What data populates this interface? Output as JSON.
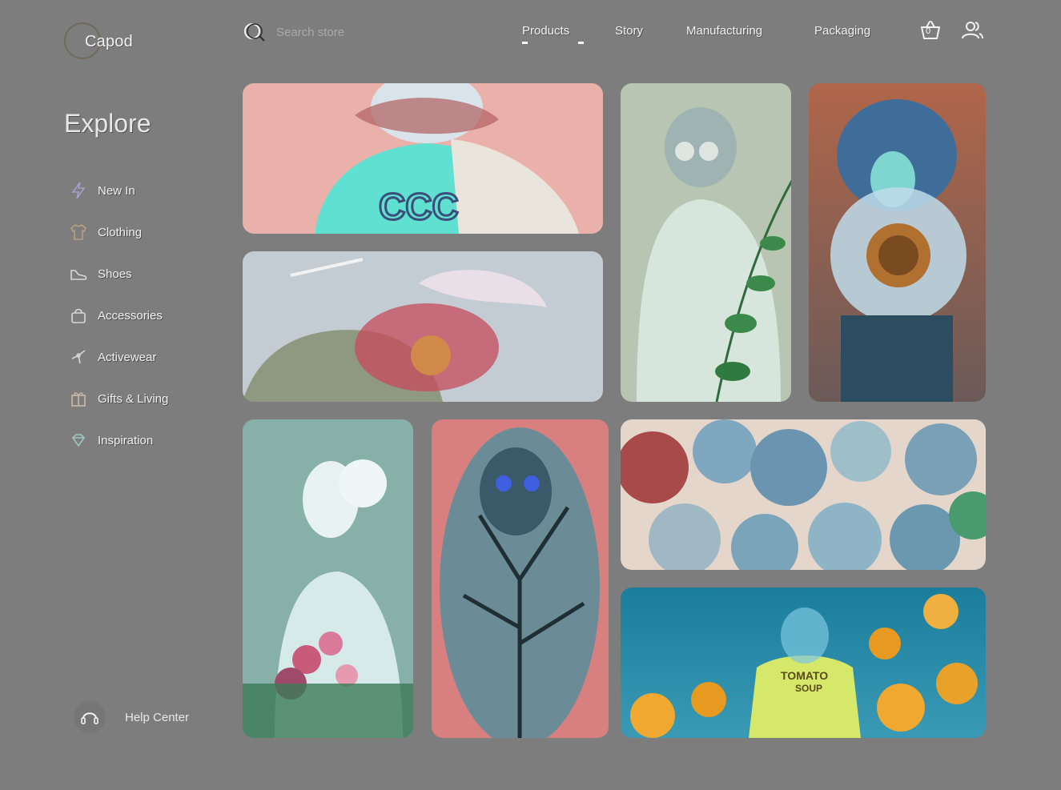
{
  "brand": {
    "name": "Capod"
  },
  "search": {
    "placeholder": "Search store"
  },
  "nav": {
    "items": [
      {
        "label": "Products",
        "active": true
      },
      {
        "label": "Story"
      },
      {
        "label": "Manufacturing"
      },
      {
        "label": "Packaging"
      }
    ],
    "cart_icon": "basket-icon",
    "cart_count": "0",
    "account_icon": "users-icon"
  },
  "sidebar": {
    "title": "Explore",
    "items": [
      {
        "label": "New In",
        "icon": "lightning-icon"
      },
      {
        "label": "Clothing",
        "icon": "shirt-icon"
      },
      {
        "label": "Shoes",
        "icon": "shoe-icon"
      },
      {
        "label": "Accessories",
        "icon": "bag-icon"
      },
      {
        "label": "Activewear",
        "icon": "dumbbell-icon"
      },
      {
        "label": "Gifts & Living",
        "icon": "gift-icon"
      },
      {
        "label": "Inspiration",
        "icon": "diamond-icon"
      }
    ],
    "help_label": "Help Center",
    "help_icon": "headset-icon"
  },
  "gallery": {
    "tiles": [
      {
        "name": "tile-pink-jacket",
        "bg": "#eab1ab"
      },
      {
        "name": "tile-portrait-plant",
        "bg": "#b8c5b2"
      },
      {
        "name": "tile-sunflower-face",
        "bg": "#8a5a48"
      },
      {
        "name": "tile-bow-flower",
        "bg": "#c3ccd3"
      },
      {
        "name": "tile-statue-flowers",
        "bg": "#86b0a8"
      },
      {
        "name": "tile-tree-portrait",
        "bg": "#6b8c97"
      },
      {
        "name": "tile-chrysanthemums",
        "bg": "#7fa8a8"
      },
      {
        "name": "tile-poppies-shirt",
        "bg": "#2d8aa6"
      }
    ]
  }
}
